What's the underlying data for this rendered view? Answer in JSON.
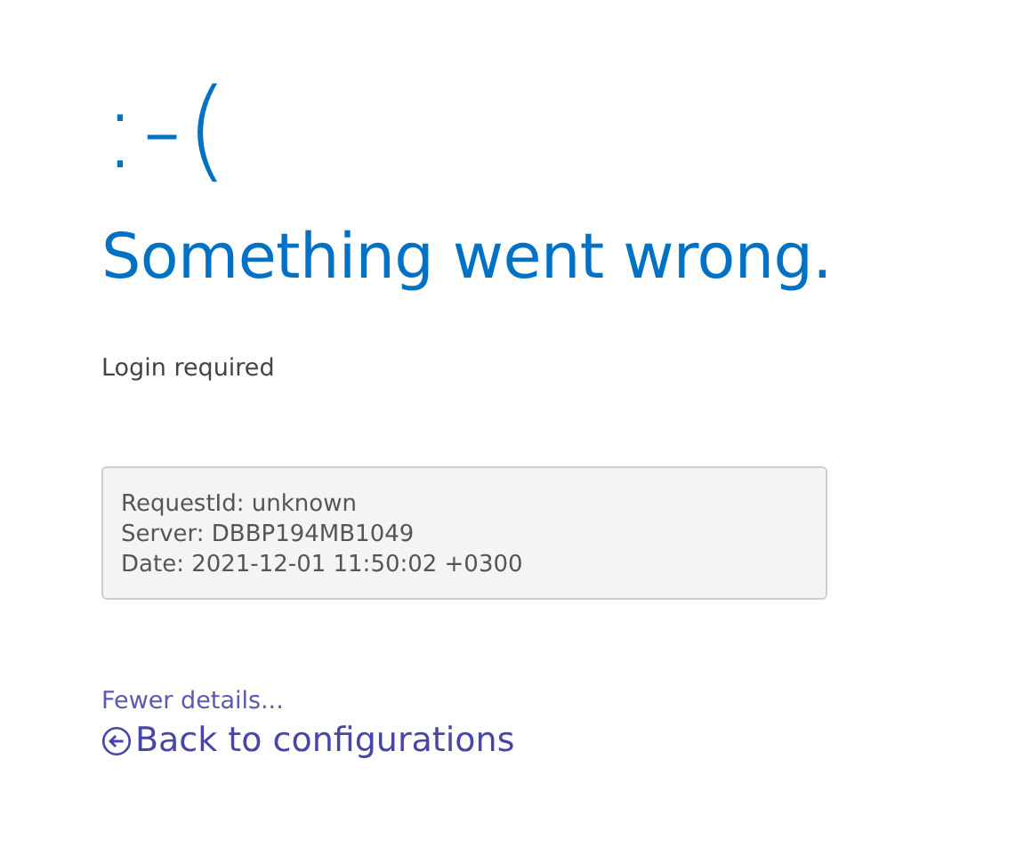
{
  "emoticon": ":-(",
  "title": "Something went wrong.",
  "message": "Login required",
  "details": [
    "RequestId: unknown",
    "Server: DBBP194MB1049",
    "Date: 2021-12-01 11:50:02 +0300"
  ],
  "details_link": "Fewer details...",
  "back_link": "Back to configurations"
}
